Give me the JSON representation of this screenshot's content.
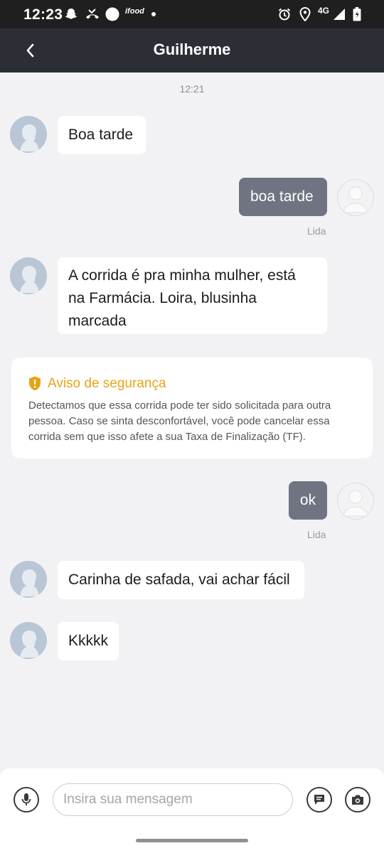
{
  "status_bar": {
    "time": "12:23",
    "network": "4G",
    "icons": [
      "snapchat-icon",
      "missed-call-icon",
      "circle-app-icon",
      "ifood-icon",
      "notification-dot",
      "alarm-icon",
      "location-icon",
      "signal-icon",
      "battery-icon"
    ],
    "app_badge": "ifood"
  },
  "header": {
    "title": "Guilherme",
    "back_icon": "chevron-left-icon"
  },
  "chat": {
    "timestamp": "12:21",
    "messages": [
      {
        "direction": "in",
        "text": "Boa tarde"
      },
      {
        "direction": "out",
        "text": "boa tarde",
        "status": "Lida"
      },
      {
        "direction": "in",
        "line1": "A corrida é pra minha mulher, está",
        "line2": "na Farmácia. Loira, blusinha",
        "line3": "marcada"
      },
      {
        "direction": "out",
        "text": "ok",
        "status": "Lida"
      },
      {
        "direction": "in",
        "text": "Carinha de safada, vai achar fácil"
      },
      {
        "direction": "in",
        "text": "Kkkkk"
      }
    ]
  },
  "security_notice": {
    "title": "Aviso de segurança",
    "line1": "Detectamos que essa corrida pode ter sido solicitada para outra",
    "line2": "pessoa. Caso se sinta desconfortável, você pode cancelar essa",
    "line3": "corrida sem que isso afete a sua Taxa de Finalização (TF).",
    "icon": "shield-alert-icon",
    "accent_color": "#e8a317"
  },
  "input_bar": {
    "placeholder": "Insira sua mensagem",
    "value": "",
    "mic_icon": "microphone-icon",
    "quick_reply_icon": "message-bubble-icon",
    "camera_icon": "camera-icon"
  },
  "colors": {
    "header_bg": "#2b2e35",
    "outgoing_bubble": "#707482",
    "incoming_bubble": "#ffffff",
    "chat_bg": "#f2f2f4"
  }
}
